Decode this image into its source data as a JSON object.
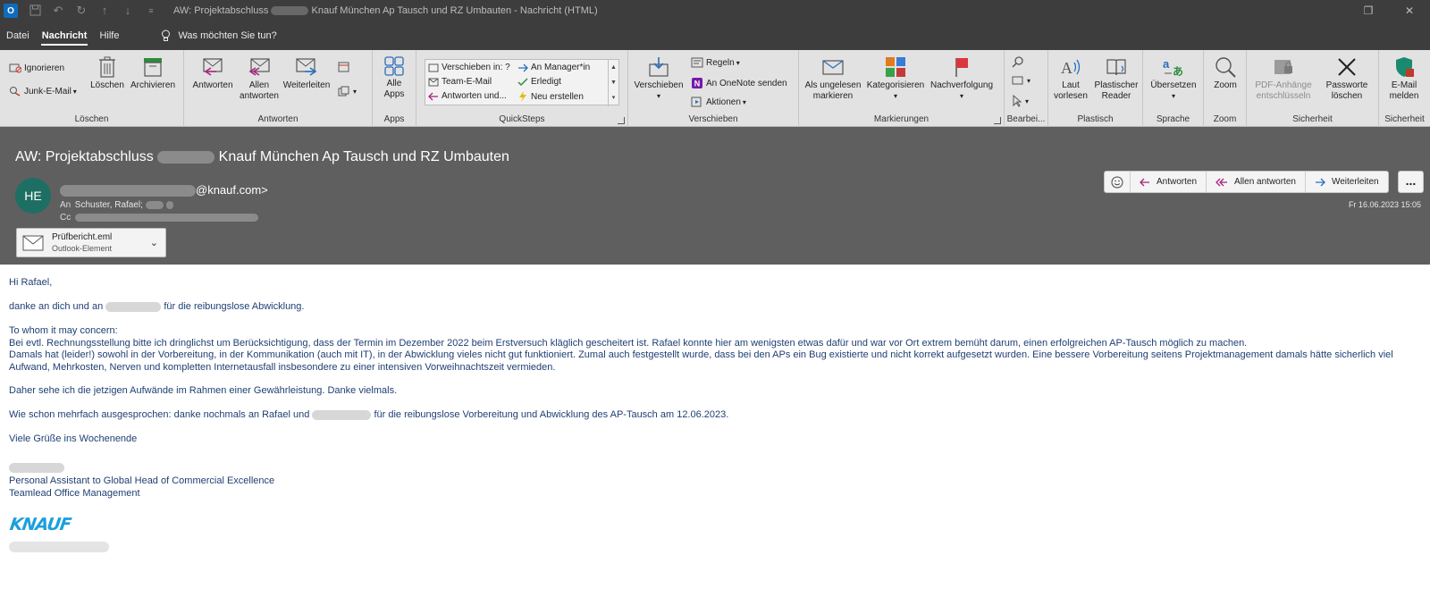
{
  "titlebar": {
    "title": "AW: Projektabschluss",
    "title_rest": "Knauf München Ap Tausch und RZ Umbauten  -  Nachricht (HTML)",
    "app_badge": "O"
  },
  "menu": {
    "items": [
      "Datei",
      "Nachricht",
      "Hilfe"
    ],
    "active": "Nachricht",
    "tellme": "Was möchten Sie tun?"
  },
  "ribbon": {
    "loeschen": {
      "ignore": "Ignorieren",
      "junk": "Junk-E-Mail",
      "delete": "Löschen",
      "archive": "Archivieren",
      "label": "Löschen"
    },
    "antworten": {
      "reply": "Antworten",
      "reply_all_1": "Allen",
      "reply_all_2": "antworten",
      "forward": "Weiterleiten",
      "label": "Antworten"
    },
    "apps": {
      "all_1": "Alle",
      "all_2": "Apps",
      "label": "Apps"
    },
    "quicksteps": {
      "items": [
        "Verschieben in: ?",
        "Team-E-Mail",
        "Antworten und...",
        "An Manager*in",
        "Erledigt",
        "Neu erstellen"
      ],
      "label": "QuickSteps"
    },
    "verschieben": {
      "move": "Verschieben",
      "rules": "Regeln",
      "onenote": "An OneNote senden",
      "actions": "Aktionen",
      "label": "Verschieben"
    },
    "markierungen": {
      "unread_1": "Als ungelesen",
      "unread_2": "markieren",
      "categorize": "Kategorisieren",
      "followup": "Nachverfolgung",
      "label": "Markierungen"
    },
    "bearbeiten": {
      "label": "Bearbei..."
    },
    "plastisch": {
      "read_1": "Laut",
      "read_2": "vorlesen",
      "reader_1": "Plastischer",
      "reader_2": "Reader",
      "label": "Plastisch"
    },
    "sprache": {
      "translate": "Übersetzen",
      "label": "Sprache"
    },
    "zoom": {
      "zoom": "Zoom",
      "label": "Zoom"
    },
    "sicherheit": {
      "pdf_1": "PDF-Anhänge",
      "pdf_2": "entschlüsseln",
      "pw_1": "Passworte",
      "pw_2": "löschen",
      "label": "Sicherheit"
    },
    "sicherheit2": {
      "report_1": "E-Mail",
      "report_2": "melden",
      "label": "Sicherheit"
    }
  },
  "message": {
    "subject_start": "AW: Projektabschluss",
    "subject_end": "Knauf München Ap Tausch und RZ Umbauten",
    "avatar_initials": "HE",
    "sender_suffix": "@knauf.com>",
    "to_label": "An",
    "to_value": "Schuster, Rafael;",
    "cc_label": "Cc",
    "attachment_name": "Prüfbericht.eml",
    "attachment_type": "Outlook-Element",
    "actions": {
      "reply": "Antworten",
      "reply_all": "Allen antworten",
      "forward": "Weiterleiten",
      "more": "..."
    },
    "datetime": "Fr 16.06.2023 15:05"
  },
  "body": {
    "greeting": "Hi Rafael,",
    "thanks_start": "danke an dich und an",
    "thanks_end": "für die reibungslose Abwicklung.",
    "concern": "To whom it may concern:",
    "para1": "Bei evtl. Rechnungsstellung bitte ich dringlichst um Berücksichtigung, dass der Termin im Dezember 2022 beim Erstversuch kläglich gescheitert ist. Rafael konnte hier am wenigsten etwas dafür und war vor Ort extrem bemüht darum, einen erfolgreichen AP-Tausch möglich zu machen.",
    "para2": "Damals hat (leider!) sowohl in der Vorbereitung, in der Kommunikation (auch mit IT), in der Abwicklung vieles nicht gut funktioniert. Zumal auch festgestellt wurde, dass bei den APs ein Bug existierte und nicht korrekt aufgesetzt wurden. Eine bessere Vorbereitung seitens Projektmanagement damals hätte sicherlich viel Aufwand, Mehrkosten, Nerven und kompletten Internetausfall insbesondere zu einer intensiven Vorweihnachtszeit vermieden.",
    "para3": "Daher sehe ich die jetzigen Aufwände im Rahmen einer Gewährleistung. Danke vielmals.",
    "para4_start": "Wie schon mehrfach ausgesprochen: danke nochmals an Rafael und",
    "para4_end": "für die reibungslose Vorbereitung und Abwicklung des AP-Tausch am 12.06.2023.",
    "closing": "Viele Grüße ins Wochenende",
    "sig_title1": "Personal Assistant to Global Head of Commercial Excellence",
    "sig_title2": "Teamlead Office Management",
    "logo_text": "KNAUF"
  }
}
